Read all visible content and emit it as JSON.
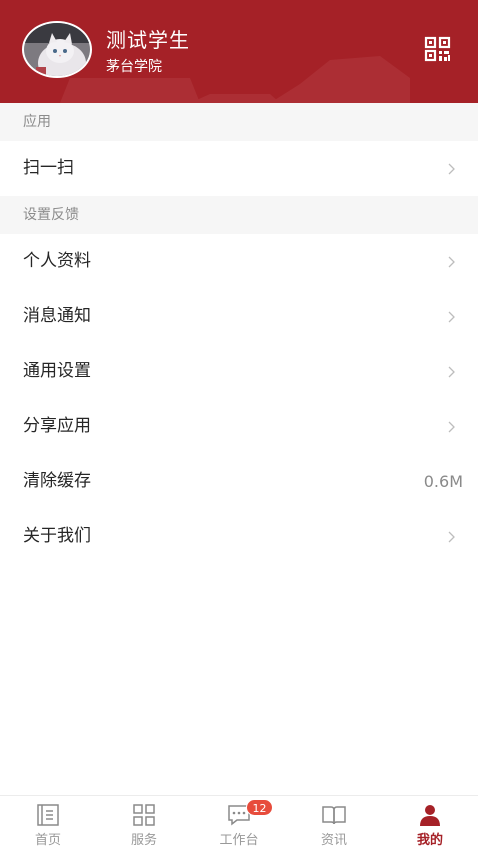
{
  "profile": {
    "name": "测试学生",
    "school": "茅台学院"
  },
  "icons": {
    "qr": "qrcode-icon",
    "chevron": "chevron-right-icon",
    "home": "home-icon",
    "services": "grid-icon",
    "workbench": "chat-icon",
    "news": "book-icon",
    "mine": "person-icon"
  },
  "colors": {
    "brand": "#a52127",
    "badge": "#e74c3c"
  },
  "sections": {
    "apps": {
      "title": "应用",
      "items": [
        {
          "label": "扫一扫"
        }
      ]
    },
    "settings": {
      "title": "设置反馈",
      "items": [
        {
          "label": "个人资料"
        },
        {
          "label": "消息通知"
        },
        {
          "label": "通用设置"
        },
        {
          "label": "分享应用"
        },
        {
          "label": "清除缓存",
          "value": "0.6M"
        },
        {
          "label": "关于我们"
        }
      ]
    }
  },
  "nav": {
    "items": [
      {
        "label": "首页"
      },
      {
        "label": "服务"
      },
      {
        "label": "工作台",
        "badge": "12"
      },
      {
        "label": "资讯"
      },
      {
        "label": "我的",
        "active": true
      }
    ]
  }
}
